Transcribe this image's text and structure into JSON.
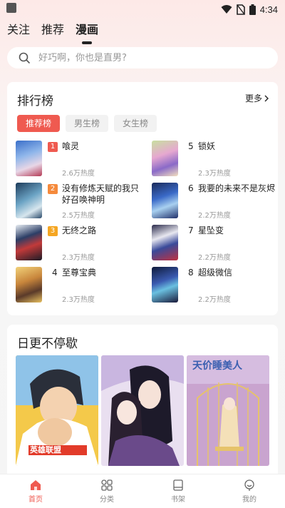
{
  "status": {
    "time": "4:34"
  },
  "top_tabs": [
    "关注",
    "推荐",
    "漫画"
  ],
  "search": {
    "placeholder": "好巧啊，你也是直男?"
  },
  "ranking": {
    "title": "排行榜",
    "more": "更多",
    "pills": [
      "推荐榜",
      "男生榜",
      "女生榜"
    ],
    "items": [
      {
        "rank": "1",
        "title": "喰灵",
        "heat": "2.6万热度"
      },
      {
        "rank": "2",
        "title": "没有修炼天赋的我只好召唤神明",
        "heat": "2.5万热度"
      },
      {
        "rank": "3",
        "title": "无终之路",
        "heat": "2.3万热度"
      },
      {
        "rank": "4",
        "title": "至尊宝典",
        "heat": "2.3万热度"
      },
      {
        "rank": "5",
        "title": "锁妖",
        "heat": "2.3万热度"
      },
      {
        "rank": "6",
        "title": "我要的未来不是灰烬",
        "heat": "2.2万热度"
      },
      {
        "rank": "7",
        "title": "星坠变",
        "heat": "2.2万热度"
      },
      {
        "rank": "8",
        "title": "超级微信",
        "heat": "2.2万热度"
      }
    ],
    "badge_colors": {
      "1": "#ef5a50",
      "2": "#f58a3c",
      "3": "#f5a623"
    }
  },
  "daily": {
    "title": "日更不停歇",
    "covers": [
      {
        "name": "cover-hero",
        "text": "英雄联盟"
      },
      {
        "name": "cover-romance",
        "text": ""
      },
      {
        "name": "cover-beauty",
        "text": "天价睡美人"
      }
    ]
  },
  "bottom_nav": [
    {
      "label": "首页",
      "icon": "home-icon",
      "active": true
    },
    {
      "label": "分类",
      "icon": "grid-icon",
      "active": false
    },
    {
      "label": "书架",
      "icon": "bookshelf-icon",
      "active": false
    },
    {
      "label": "我的",
      "icon": "profile-icon",
      "active": false
    }
  ],
  "colors": {
    "accent": "#ef5a50"
  }
}
